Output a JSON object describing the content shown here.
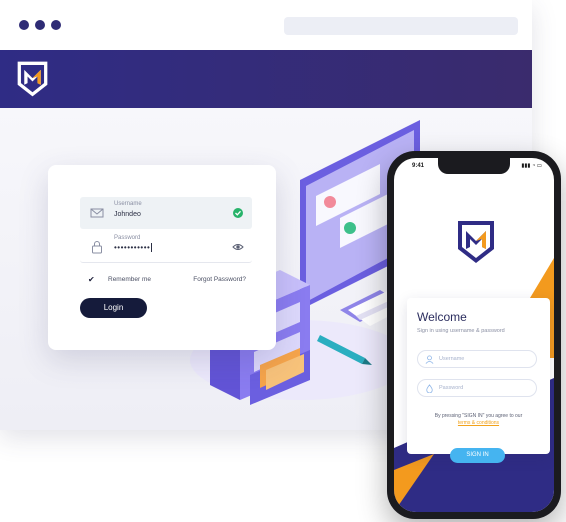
{
  "login_card": {
    "username_label": "Username",
    "username_value": "Johndeo",
    "password_label": "Password",
    "password_value": "•••••••••••",
    "remember_label": "Remember me",
    "forgot_label": "Forgot Password?",
    "login_button": "Login"
  },
  "phone": {
    "time": "9:41",
    "status_icons": "▮▮▮ ◔ ▭",
    "welcome_title": "Welcome",
    "welcome_subtitle": "Sign in using username & password",
    "username_placeholder": "Username",
    "password_placeholder": "Password",
    "terms_prefix": "By pressing \"SIGN IN\" you agree to our",
    "terms_link": "terms & conditions",
    "signin_button": "SIGN IN"
  },
  "colors": {
    "brand_navy": "#2f2c85",
    "brand_orange": "#f39a1e",
    "accent_blue": "#45b4f0",
    "success_green": "#27b36a"
  },
  "icons": [
    "brand-logo-icon",
    "envelope-icon",
    "check-circle-icon",
    "lock-icon",
    "eye-icon",
    "checkbox-icon",
    "user-icon",
    "drop-icon"
  ]
}
